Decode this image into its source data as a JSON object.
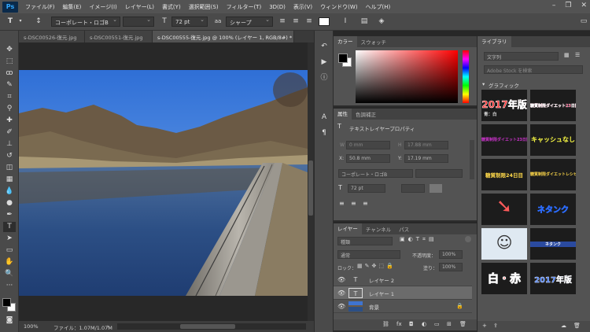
{
  "app": {
    "logo": "Ps"
  },
  "menu": [
    "ファイル(F)",
    "編集(E)",
    "イメージ(I)",
    "レイヤー(L)",
    "書式(Y)",
    "選択範囲(S)",
    "フィルター(T)",
    "3D(D)",
    "表示(V)",
    "ウィンドウ(W)",
    "ヘルプ(H)"
  ],
  "options": {
    "font_family": "コーポレート・ロゴB",
    "font_size": "72 pt",
    "antialias": "シャープ"
  },
  "tabs": [
    "s-DSC00526-復元.jpg",
    "s-DSC00551-復元.jpg",
    "s-DSC00555-復元.jpg @ 100% (レイヤー 1, RGB/8#) *"
  ],
  "status": {
    "zoom": "100%",
    "file": "ファイル：1.07M/1.07M"
  },
  "color_panel": {
    "tabs": [
      "カラー",
      "スウォッチ"
    ]
  },
  "props_panel": {
    "tabs": [
      "属性",
      "色調補正"
    ],
    "title": "テキストレイヤープロパティ",
    "w_label": "W",
    "w_value": "0 mm",
    "h_label": "H",
    "h_value": "17.88 mm",
    "x_label": "X:",
    "x_value": "50.8 mm",
    "y_label": "Y:",
    "y_value": "17.19 mm",
    "font": "コーポレート・ロゴB",
    "size": "72 pt"
  },
  "layers_panel": {
    "tabs": [
      "レイヤー",
      "チャンネル",
      "パス"
    ],
    "filter": "種類",
    "blend": "通常",
    "opacity_label": "不透明度：",
    "opacity": "100%",
    "lock_label": "ロック：",
    "fill_label": "塗り：",
    "fill": "100%",
    "layers": [
      {
        "name": "レイヤー 2",
        "thumb": "T",
        "active": false
      },
      {
        "name": "レイヤー 1",
        "thumb": "T",
        "active": true
      },
      {
        "name": "背景",
        "thumb": "",
        "active": false
      }
    ]
  },
  "library_panel": {
    "tab": "ライブラリ",
    "dropdown": "文字列",
    "search": "Adobe Stock を検索",
    "section": "グラフィック",
    "tiles": [
      {
        "text": "2017年版",
        "sub": "青：白",
        "color": "#ff2a2a"
      },
      {
        "text": "糖質制限ダイエット23日間",
        "sub": "",
        "color": "#ff2a6a"
      },
      {
        "text": "糖質制限ダイエット23日間",
        "sub": "",
        "color": "#cc33cc"
      },
      {
        "text": "キャッシュなし",
        "sub": "",
        "color": "#ffff44"
      },
      {
        "text": "糖質制限24日目",
        "sub": "",
        "color": "#ffd94a"
      },
      {
        "text": "糖質制限ダイエットレシピ",
        "sub": "",
        "color": "#ffd94a"
      },
      {
        "text": "",
        "sub": "",
        "color": "#ff5a5a"
      },
      {
        "text": "ネタンク",
        "sub": "",
        "color": "#ffffff"
      },
      {
        "text": "",
        "sub": "",
        "color": "#ffffff"
      },
      {
        "text": "ネタンク",
        "sub": "",
        "color": "#ffffff"
      },
      {
        "text": "白・赤",
        "sub": "",
        "color": "#ff2020"
      },
      {
        "text": "2017年版",
        "sub": "",
        "color": "#2a6bff"
      }
    ]
  }
}
